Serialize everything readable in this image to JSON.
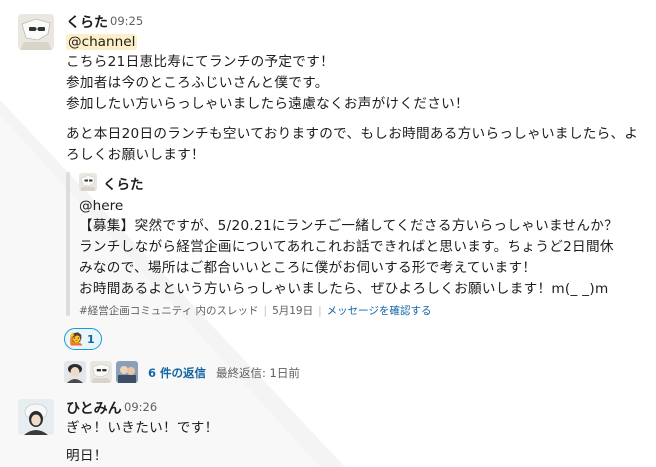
{
  "messages": [
    {
      "author": "くらた",
      "time": "09:25",
      "mention": "@channel",
      "lines": [
        "こちら21日恵比寿にてランチの予定です！",
        "参加者は今のところふじいさんと僕です。",
        "参加したい方いらっしゃいましたら遠慮なくお声がけください！"
      ],
      "lines2": [
        "あと本日20日のランチも空いておりますので、もしお時間ある方いらっしゃいましたら、よ",
        "ろしくお願いします！"
      ],
      "quote": {
        "author": "くらた",
        "mention": "@here",
        "lines": [
          "【募集】突然ですが、5/20.21にランチご一緒してくださる方いらっしゃいませんか？",
          "ランチしながら経営企画についてあれこれお話できればと思います。ちょうど2日間休",
          "みなので、場所はご都合いいところに僕がお伺いする形で考えています！",
          "お時間あるよという方いらっしゃいましたら、ぜひよろしくお願いします！m(_ _)m"
        ],
        "meta": {
          "channel": "#経営企画コミュニティ 内のスレッド",
          "date": "5月19日",
          "link": "メッセージを確認する"
        }
      },
      "reaction": {
        "emoji": "🙋",
        "count": "1"
      },
      "thread": {
        "replies": "6 件の返信",
        "last_reply": "最終返信: 1日前"
      }
    },
    {
      "author": "ひとみん",
      "time": "09:26",
      "lines": [
        "ぎゃ！いきたい！です！",
        "明日！"
      ]
    }
  ],
  "colors": {
    "link": "#1264a3",
    "mention_bg": "#fdf0c9",
    "reaction_border": "#1d9bd1",
    "reaction_bg": "#e8f5fa",
    "background_shape": "#f3f3f3"
  }
}
